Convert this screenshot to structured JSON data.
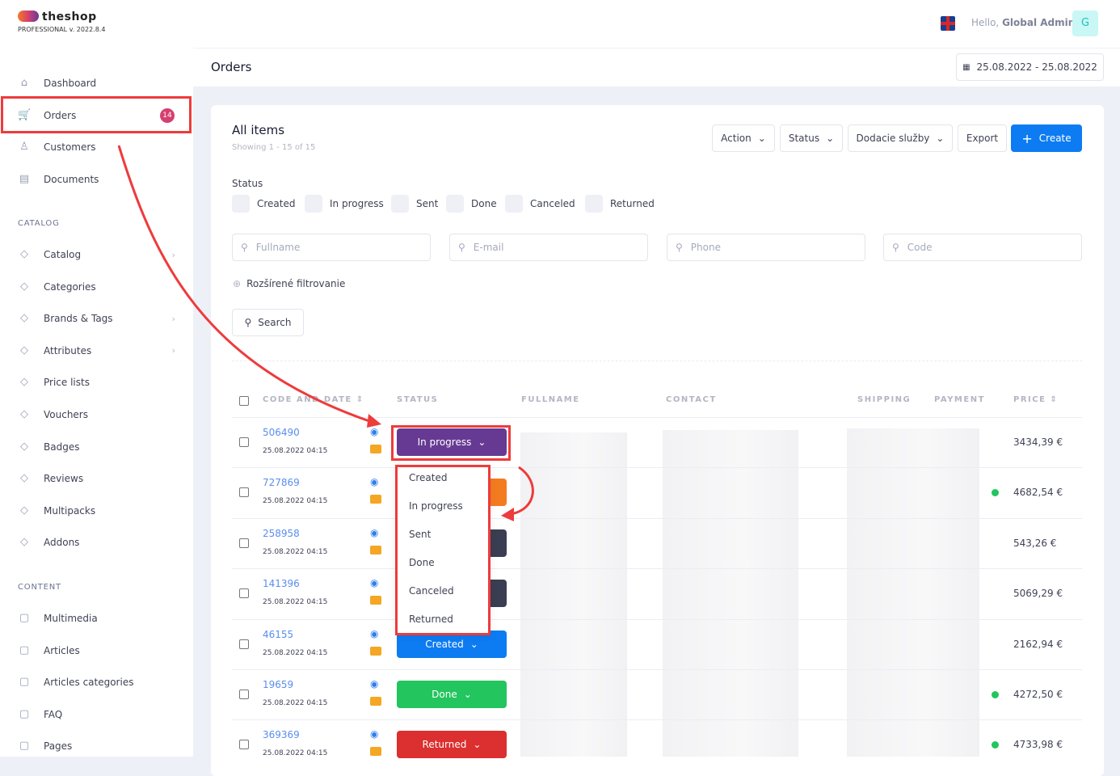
{
  "brand": {
    "name": "theshop",
    "edition": "PROFESSIONAL v. 2022.8.4"
  },
  "sidebar": {
    "items": [
      {
        "label": "Dashboard",
        "icon": "home-icon"
      },
      {
        "label": "Orders",
        "icon": "cart-icon",
        "badge": "14",
        "active": true
      },
      {
        "label": "Customers",
        "icon": "user-icon"
      },
      {
        "label": "Documents",
        "icon": "documents-icon"
      }
    ],
    "catalog_title": "CATALOG",
    "catalog": [
      {
        "label": "Catalog",
        "chevron": true
      },
      {
        "label": "Categories"
      },
      {
        "label": "Brands & Tags",
        "chevron": true
      },
      {
        "label": "Attributes",
        "chevron": true
      },
      {
        "label": "Price lists"
      },
      {
        "label": "Vouchers"
      },
      {
        "label": "Badges"
      },
      {
        "label": "Reviews"
      },
      {
        "label": "Multipacks"
      },
      {
        "label": "Addons"
      }
    ],
    "content_title": "CONTENT",
    "content": [
      {
        "label": "Multimedia"
      },
      {
        "label": "Articles"
      },
      {
        "label": "Articles categories"
      },
      {
        "label": "FAQ"
      },
      {
        "label": "Pages"
      }
    ]
  },
  "header": {
    "greeting": "Hello,",
    "user": "Global Admin",
    "avatar": "G",
    "page_title": "Orders",
    "date_range": "25.08.2022 - 25.08.2022"
  },
  "card": {
    "title": "All items",
    "showing": "Showing 1 - 15 of 15",
    "buttons": {
      "action": "Action",
      "status": "Status",
      "shipping": "Dodacie služby",
      "export": "Export",
      "create": "Create"
    },
    "status_label": "Status",
    "status_filters": [
      "Created",
      "In progress",
      "Sent",
      "Done",
      "Canceled",
      "Returned"
    ],
    "inputs": {
      "fullname": "Fullname",
      "email": "E-mail",
      "phone": "Phone",
      "code": "Code"
    },
    "advanced": "Rozšírené filtrovanie",
    "search": "Search"
  },
  "table": {
    "headers": {
      "code": "CODE AND DATE",
      "status": "STATUS",
      "fullname": "FULLNAME",
      "contact": "CONTACT",
      "shipping": "SHIPPING",
      "payment": "PAYMENT",
      "price": "PRICE"
    },
    "rows": [
      {
        "code": "506490",
        "date": "25.08.2022 04:15",
        "status": "In progress",
        "color": "#663a93",
        "price": "3434,39 €",
        "paid": false
      },
      {
        "code": "727869",
        "date": "25.08.2022 04:15",
        "status": "",
        "color": "#f47c20",
        "price": "4682,54 €",
        "paid": true
      },
      {
        "code": "258958",
        "date": "25.08.2022 04:15",
        "status": "",
        "color": "#3b3e52",
        "price": "543,26 €",
        "paid": false
      },
      {
        "code": "141396",
        "date": "25.08.2022 04:15",
        "status": "",
        "color": "#3b3e52",
        "price": "5069,29 €",
        "paid": false
      },
      {
        "code": "46155",
        "date": "25.08.2022 04:15",
        "status": "Created",
        "color": "#0d7cf2",
        "price": "2162,94 €",
        "paid": false
      },
      {
        "code": "19659",
        "date": "25.08.2022 04:15",
        "status": "Done",
        "color": "#22c55e",
        "price": "4272,50 €",
        "paid": true
      },
      {
        "code": "369369",
        "date": "25.08.2022 04:15",
        "status": "Returned",
        "color": "#dc2f2f",
        "price": "4733,98 €",
        "paid": true
      }
    ]
  },
  "dropdown": [
    "Created",
    "In progress",
    "Sent",
    "Done",
    "Canceled",
    "Returned"
  ],
  "colors": {
    "accent": "#0d7cf2",
    "annotation": "#ee3b3b"
  }
}
